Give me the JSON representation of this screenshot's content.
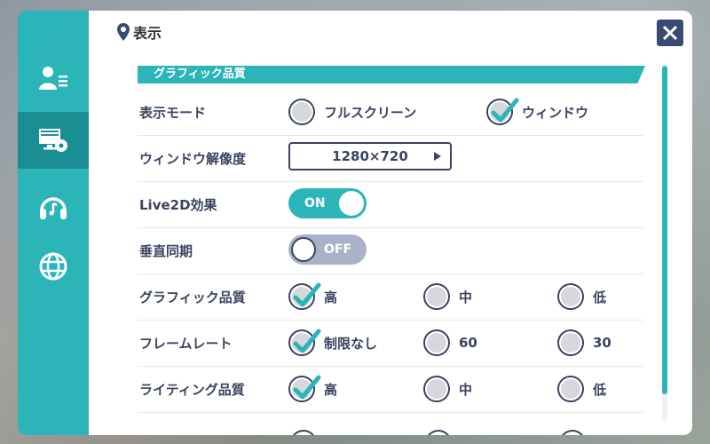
{
  "header": {
    "title": "表示"
  },
  "section": {
    "title": "グラフィック品質"
  },
  "sidebar": {
    "items": [
      {
        "icon": "user-list-icon",
        "active": false
      },
      {
        "icon": "display-settings-icon",
        "active": true
      },
      {
        "icon": "headphones-icon",
        "active": false
      },
      {
        "icon": "globe-icon",
        "active": false
      }
    ]
  },
  "settings": {
    "display_mode": {
      "label": "表示モード",
      "options": [
        "フルスクリーン",
        "ウィンドウ"
      ],
      "selected": "ウィンドウ"
    },
    "window_resolution": {
      "label": "ウィンドウ解像度",
      "value": "1280×720"
    },
    "live2d": {
      "label": "Live2D効果",
      "state": "ON"
    },
    "vsync": {
      "label": "垂直同期",
      "state": "OFF"
    },
    "graphics_quality": {
      "label": "グラフィック品質",
      "options": [
        "高",
        "中",
        "低"
      ],
      "selected": "高"
    },
    "frame_rate": {
      "label": "フレームレート",
      "options": [
        "制限なし",
        "60",
        "30"
      ],
      "selected": "制限なし"
    },
    "lighting_quality": {
      "label": "ライティング品質",
      "options": [
        "高",
        "中",
        "低"
      ],
      "selected": "高"
    }
  },
  "colors": {
    "accent": "#2bb5b9",
    "text": "#3b4360",
    "toggle_off": "#a9b3c8",
    "close_bg": "#3b4a72"
  }
}
